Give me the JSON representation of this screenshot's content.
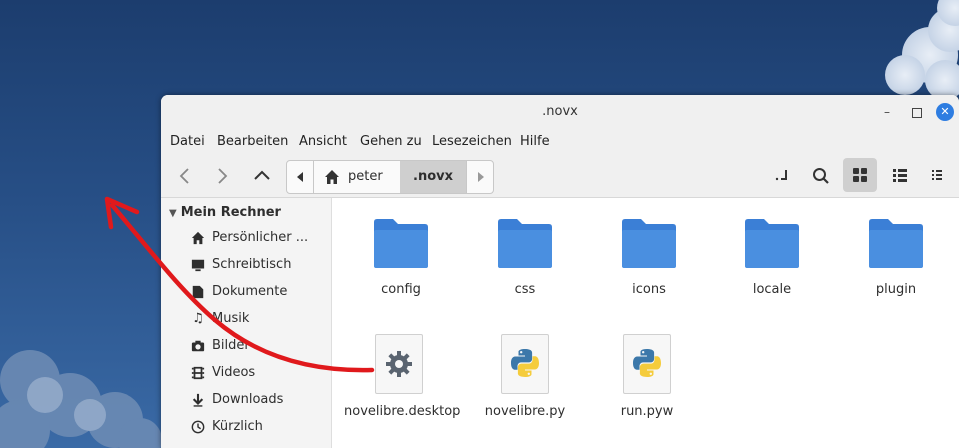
{
  "window": {
    "title": ".novx"
  },
  "menubar": [
    "Datei",
    "Bearbeiten",
    "Ansicht",
    "Gehen zu",
    "Lesezeichen",
    "Hilfe"
  ],
  "pathbar": {
    "home": "peter",
    "current": ".novx"
  },
  "sidebar": {
    "section": "Mein Rechner",
    "items": [
      {
        "label": "Persönlicher ...",
        "icon": "home-icon"
      },
      {
        "label": "Schreibtisch",
        "icon": "desktop-icon"
      },
      {
        "label": "Dokumente",
        "icon": "documents-icon"
      },
      {
        "label": "Musik",
        "icon": "music-icon"
      },
      {
        "label": "Bilder",
        "icon": "camera-icon"
      },
      {
        "label": "Videos",
        "icon": "film-icon"
      },
      {
        "label": "Downloads",
        "icon": "download-icon"
      },
      {
        "label": "Kürzlich",
        "icon": "clock-icon"
      }
    ]
  },
  "files": [
    {
      "name": "config",
      "type": "folder"
    },
    {
      "name": "css",
      "type": "folder"
    },
    {
      "name": "icons",
      "type": "folder"
    },
    {
      "name": "locale",
      "type": "folder"
    },
    {
      "name": "plugin",
      "type": "folder"
    },
    {
      "name": "novelibre.desktop",
      "type": "desktop-file"
    },
    {
      "name": "novelibre.py",
      "type": "python-file"
    },
    {
      "name": "run.pyw",
      "type": "python-file"
    }
  ],
  "colors": {
    "accent": "#2e7de1",
    "folder": "#4a8fe0",
    "folder_tab": "#3b7fd6",
    "annotation": "#e0191c"
  }
}
